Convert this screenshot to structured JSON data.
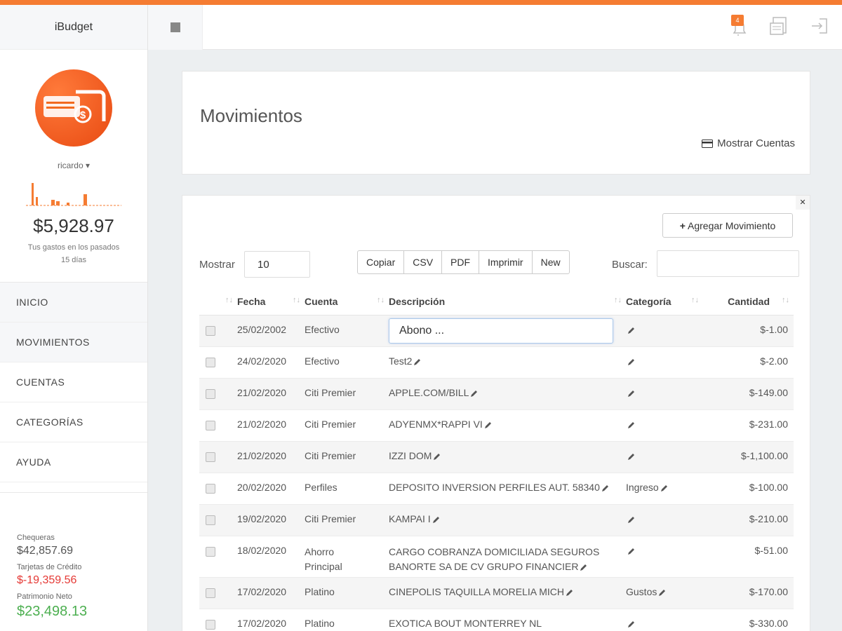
{
  "app": {
    "title": "iBudget",
    "accent": "#f57c32"
  },
  "header": {
    "notification_count": "4"
  },
  "sidebar": {
    "user": "ricardo",
    "balance": "$5,928.97",
    "balance_caption_1": "Tus gastos en los pasados",
    "balance_caption_2": "15 días",
    "nav": [
      "INICIO",
      "MOVIMIENTOS",
      "CUENTAS",
      "CATEGORÍAS",
      "AYUDA"
    ],
    "summary": [
      {
        "label": "Chequeras",
        "value": "$42,857.69"
      },
      {
        "label": "Tarjetas de Crédito",
        "value": "$-19,359.56"
      },
      {
        "label": "Patrimonio Neto",
        "value": "$23,498.13"
      }
    ]
  },
  "page": {
    "title": "Movimientos",
    "show_accounts": "Mostrar Cuentas"
  },
  "toolbar": {
    "add_label": "Agregar Movimiento",
    "show_label": "Mostrar",
    "show_value": "10",
    "exports": [
      "Copiar",
      "CSV",
      "PDF",
      "Imprimir",
      "New"
    ],
    "search_label": "Buscar:"
  },
  "table": {
    "headers": [
      "Fecha",
      "Cuenta",
      "Descripción",
      "Categoría",
      "Cantidad"
    ],
    "editing_value": "Abono ...",
    "rows": [
      {
        "fecha": "25/02/2002",
        "cuenta": "Efectivo",
        "descripcion": "",
        "categoria": "",
        "cantidad": "$-1.00"
      },
      {
        "fecha": "24/02/2020",
        "cuenta": "Efectivo",
        "descripcion": "Test2",
        "categoria": "",
        "cantidad": "$-2.00"
      },
      {
        "fecha": "21/02/2020",
        "cuenta": "Citi Premier",
        "descripcion": "APPLE.COM/BILL",
        "categoria": "",
        "cantidad": "$-149.00"
      },
      {
        "fecha": "21/02/2020",
        "cuenta": "Citi Premier",
        "descripcion": "ADYENMX*RAPPI VI",
        "categoria": "",
        "cantidad": "$-231.00"
      },
      {
        "fecha": "21/02/2020",
        "cuenta": "Citi Premier",
        "descripcion": "IZZI DOM",
        "categoria": "",
        "cantidad": "$-1,100.00"
      },
      {
        "fecha": "20/02/2020",
        "cuenta": "Perfiles",
        "descripcion": "DEPOSITO INVERSION PERFILES AUT. 58340",
        "categoria": "Ingreso",
        "cantidad": "$-100.00"
      },
      {
        "fecha": "19/02/2020",
        "cuenta": "Citi Premier",
        "descripcion": "KAMPAI I",
        "categoria": "",
        "cantidad": "$-210.00"
      },
      {
        "fecha": "18/02/2020",
        "cuenta_1": "Ahorro",
        "cuenta_2": "Principal",
        "descripcion_1": "CARGO COBRANZA DOMICILIADA SEGUROS",
        "descripcion_2": "BANORTE SA DE CV GRUPO FINANCIER",
        "categoria": "",
        "cantidad": "$-51.00"
      },
      {
        "fecha": "17/02/2020",
        "cuenta": "Platino",
        "descripcion": "CINEPOLIS TAQUILLA MORELIA MICH",
        "categoria": "Gustos",
        "cantidad": "$-170.00"
      },
      {
        "fecha": "17/02/2020",
        "cuenta": "Platino",
        "descripcion": "EXOTICA BOUT MONTERREY NL",
        "categoria": "",
        "cantidad": "$-330.00"
      }
    ]
  }
}
